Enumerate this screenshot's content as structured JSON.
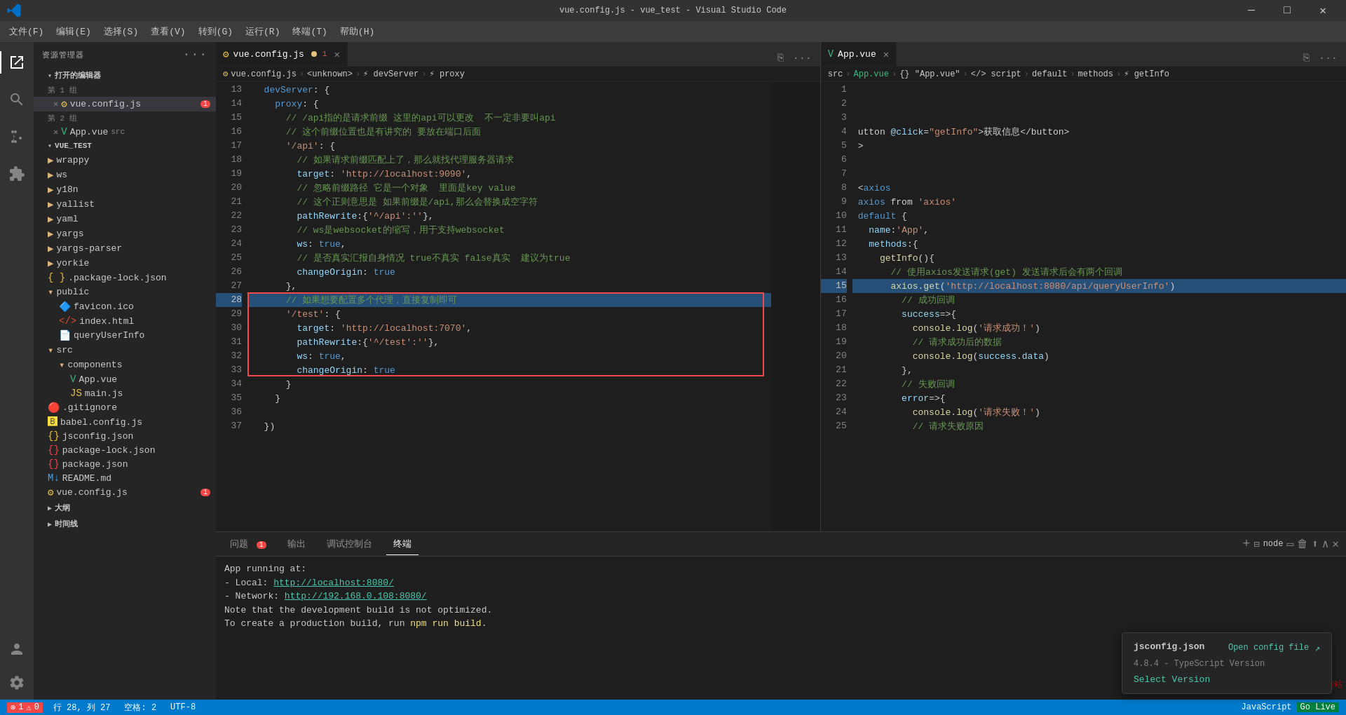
{
  "titlebar": {
    "title": "vue.config.js - vue_test - Visual Studio Code",
    "menu": [
      "文件(F)",
      "编辑(E)",
      "选择(S)",
      "查看(V)",
      "转到(G)",
      "运行(R)",
      "终端(T)",
      "帮助(H)"
    ]
  },
  "sidebar": {
    "header": "资源管理器",
    "groups": [
      {
        "label": "打开的编辑器",
        "items": [
          {
            "name": "第 1 组",
            "type": "group"
          },
          {
            "name": "vue.config.js",
            "type": "file",
            "dirty": true,
            "badge": 1,
            "active": true
          },
          {
            "name": "第 2 组",
            "type": "group"
          },
          {
            "name": "App.vue",
            "type": "file-vue",
            "suffix": "src"
          }
        ]
      },
      {
        "label": "VUE_TEST",
        "items": [
          {
            "name": "wrappy",
            "type": "folder"
          },
          {
            "name": "ws",
            "type": "folder"
          },
          {
            "name": "y18n",
            "type": "folder"
          },
          {
            "name": "yallist",
            "type": "folder"
          },
          {
            "name": "yaml",
            "type": "folder"
          },
          {
            "name": "yargs",
            "type": "folder"
          },
          {
            "name": "yargs-parser",
            "type": "folder"
          },
          {
            "name": "yorkie",
            "type": "folder"
          },
          {
            "name": ".package-lock.json",
            "type": "json"
          },
          {
            "name": "public",
            "type": "folder-open"
          },
          {
            "name": "favicon.ico",
            "type": "ico",
            "indent": 1
          },
          {
            "name": "index.html",
            "type": "html",
            "indent": 1
          },
          {
            "name": "queryUserInfo",
            "type": "file",
            "indent": 1
          },
          {
            "name": "src",
            "type": "folder-open"
          },
          {
            "name": "components",
            "type": "folder-open",
            "indent": 1
          },
          {
            "name": "App.vue",
            "type": "vue",
            "indent": 2
          },
          {
            "name": "main.js",
            "type": "js",
            "indent": 2
          },
          {
            "name": ".gitignore",
            "type": "git"
          },
          {
            "name": "babel.config.js",
            "type": "babel"
          },
          {
            "name": "jsconfig.json",
            "type": "json"
          },
          {
            "name": "package-lock.json",
            "type": "json"
          },
          {
            "name": "package.json",
            "type": "json"
          },
          {
            "name": "README.md",
            "type": "md"
          },
          {
            "name": "vue.config.js",
            "type": "vue-config",
            "badge": 1
          }
        ]
      },
      {
        "label": "大纲"
      },
      {
        "label": "时间线"
      }
    ]
  },
  "editor1": {
    "filename": "vue.config.js",
    "dirty": true,
    "breadcrumb": [
      "vue.config.js",
      "<unknown>",
      "devServer",
      "proxy"
    ],
    "lines": [
      {
        "num": 13,
        "code": "  devServer: {"
      },
      {
        "num": 14,
        "code": "    proxy: {"
      },
      {
        "num": 15,
        "code": "      // /api指的是请求前缀 这里的api可以更改  不一定非要叫api"
      },
      {
        "num": 16,
        "code": "      // 这个前缀位置也是有讲究的 要放在端口后面"
      },
      {
        "num": 17,
        "code": "      '/api': {"
      },
      {
        "num": 18,
        "code": "        // 如果请求前缀匹配上了，那么就找代理服务器请求"
      },
      {
        "num": 19,
        "code": "        target: 'http://localhost:9090',"
      },
      {
        "num": 20,
        "code": "        // 忽略前缀路径 它是一个对象  里面是key value"
      },
      {
        "num": 21,
        "code": "        // 这个正则意思是 如果前缀是/api,那么会替换成空字符"
      },
      {
        "num": 22,
        "code": "        pathRewrite:{'^/api':''},"
      },
      {
        "num": 23,
        "code": "        // ws是websocket的缩写，用于支持websocket"
      },
      {
        "num": 24,
        "code": "        ws: true,"
      },
      {
        "num": 25,
        "code": "        // 是否真实汇报自身情况 true不真实 false真实  建议为true"
      },
      {
        "num": 26,
        "code": "        changeOrigin: true"
      },
      {
        "num": 27,
        "code": "      },"
      },
      {
        "num": 28,
        "code": "      // 如果想要配置多个代理，直接复制即可"
      },
      {
        "num": 29,
        "code": "      '/test': {"
      },
      {
        "num": 30,
        "code": "        target: 'http://localhost:7070',"
      },
      {
        "num": 31,
        "code": "        pathRewrite:{'^/test':''},"
      },
      {
        "num": 32,
        "code": "        ws: true,"
      },
      {
        "num": 33,
        "code": "        changeOrigin: true"
      },
      {
        "num": 34,
        "code": "      }"
      },
      {
        "num": 35,
        "code": "    }"
      },
      {
        "num": 36,
        "code": ""
      },
      {
        "num": 37,
        "code": "  })"
      }
    ]
  },
  "editor2": {
    "filename": "App.vue",
    "breadcrumb": [
      "src",
      "App.vue",
      "{} \"App.vue\"",
      "script",
      "default",
      "methods",
      "getInfo"
    ],
    "lines": [
      {
        "num": 1,
        "code": ""
      },
      {
        "num": 2,
        "code": ""
      },
      {
        "num": 3,
        "code": ""
      },
      {
        "num": 4,
        "code": "utton @click=\"getInfo\">获取信息</button>"
      },
      {
        "num": 5,
        "code": ">"
      },
      {
        "num": 6,
        "code": ""
      },
      {
        "num": 7,
        "code": ""
      },
      {
        "num": 8,
        "code": "<axios"
      },
      {
        "num": 9,
        "code": "axios from 'axios'"
      },
      {
        "num": 10,
        "code": "default {"
      },
      {
        "num": 11,
        "code": "  name:'App',"
      },
      {
        "num": 12,
        "code": "  methods:{"
      },
      {
        "num": 13,
        "code": "    getInfo(){"
      },
      {
        "num": 14,
        "code": "      // 使用axios发送请求(get) 发送请求后会有两个回调"
      },
      {
        "num": 15,
        "code": "      axios.get('http://localhost:8080/api/queryUserInfo')"
      },
      {
        "num": 16,
        "code": "        // 成功回调"
      },
      {
        "num": 17,
        "code": "        success=>{"
      },
      {
        "num": 18,
        "code": "          console.log('请求成功！')"
      },
      {
        "num": 19,
        "code": "          // 请求成功后的数据"
      },
      {
        "num": 20,
        "code": "          console.log(success.data)"
      },
      {
        "num": 21,
        "code": "        },"
      },
      {
        "num": 22,
        "code": "        // 失败回调"
      },
      {
        "num": 23,
        "code": "        error=>{"
      },
      {
        "num": 24,
        "code": "          console.log('请求失败！')"
      },
      {
        "num": 25,
        "code": "          // 请求失败原因"
      }
    ]
  },
  "terminal": {
    "tabs": [
      "问题",
      "输出",
      "调试控制台",
      "终端"
    ],
    "active_tab": "终端",
    "problem_count": 1,
    "content": [
      "App running at:",
      "  - Local:   http://localhost:8080/",
      "  - Network: http://192.168.0.108:8080/",
      "",
      "Note that the development build is not optimized.",
      "To create a production build, run npm run build."
    ]
  },
  "statusbar": {
    "error_count": "1",
    "warning_count": "0",
    "branch": "",
    "row": "行 28",
    "col": "列 27",
    "spaces": "空格: 2",
    "encoding": "UTF-8",
    "language": "JavaScript",
    "typescript_version": "4.8.4 - TypeScript Version",
    "select_version": "Select Version"
  },
  "notification": {
    "title": "jsconfig.json",
    "link1": "Open config file",
    "icon1": "↗",
    "typescript_label": "4.8.4 - TypeScript Version",
    "select_version": "Select Version"
  }
}
